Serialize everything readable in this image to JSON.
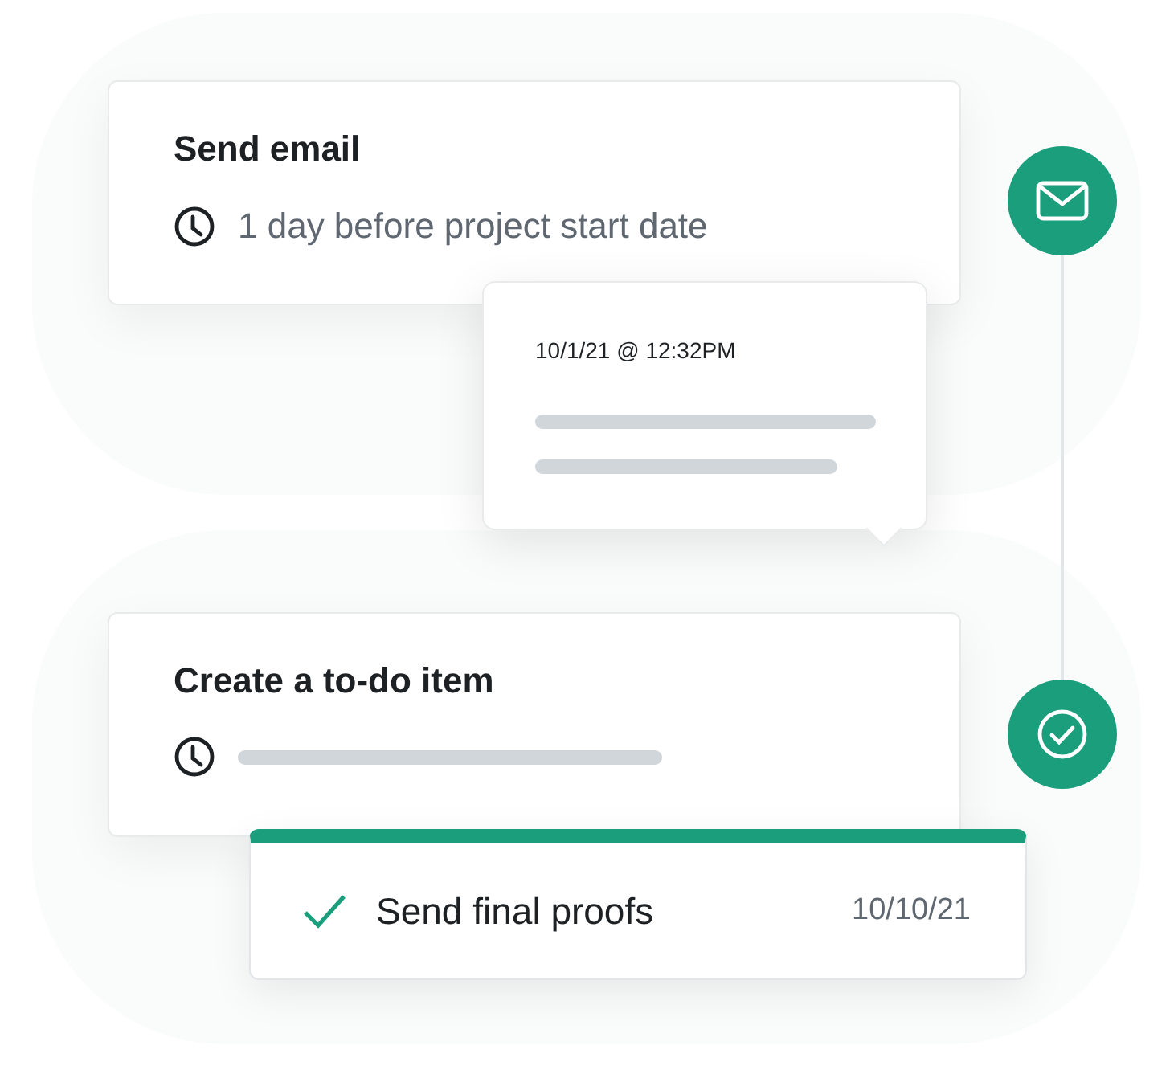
{
  "steps": [
    {
      "kind": "email",
      "title": "Send email",
      "timing": "1 day before project start date"
    },
    {
      "kind": "todo",
      "title": "Create a to-do item"
    }
  ],
  "popover": {
    "timestamp": "10/1/21 @ 12:32PM"
  },
  "todo_item": {
    "label": "Send final proofs",
    "date": "10/10/21",
    "done": true
  }
}
